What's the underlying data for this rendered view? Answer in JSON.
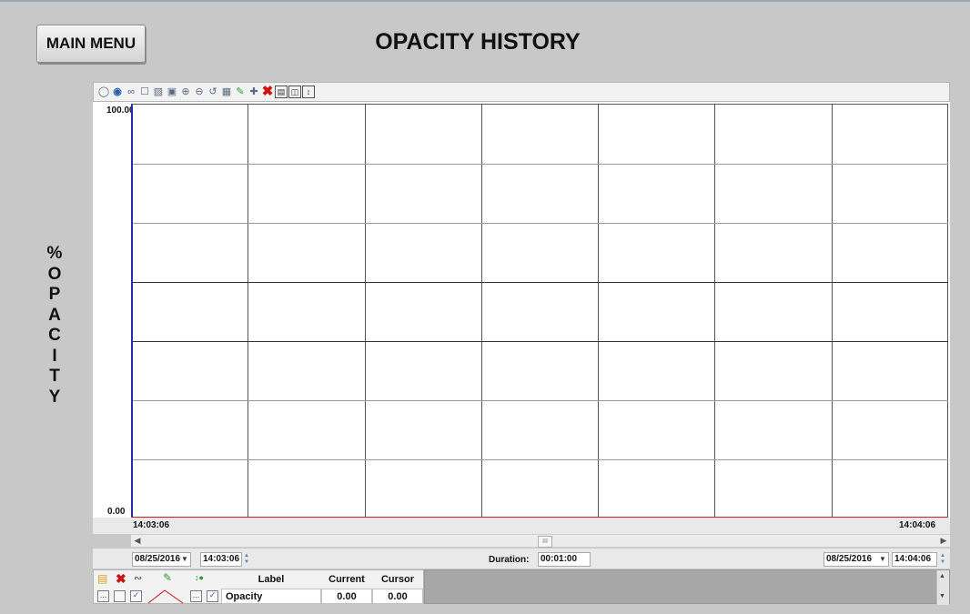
{
  "header": {
    "main_menu_label": "MAIN MENU",
    "title": "OPACITY HISTORY"
  },
  "y_axis_label": [
    "%",
    "O",
    "P",
    "A",
    "C",
    "I",
    "T",
    "Y"
  ],
  "toolbar": {
    "icons": [
      "refresh-icon",
      "info-icon",
      "link-icon",
      "zoom-box-icon",
      "zoom-range-icon",
      "zoom-fit-icon",
      "zoom-in-icon",
      "zoom-out-icon",
      "zoom-reset-icon",
      "grid-icon",
      "edit-pen-icon",
      "add-cursor-icon",
      "delete-icon",
      "panel-icon",
      "layout-icon",
      "scale-icon"
    ]
  },
  "chart_data": {
    "type": "line",
    "title": "OPACITY HISTORY",
    "ylabel": "% OPACITY",
    "xlabel": "",
    "ylim": [
      0.0,
      100.0
    ],
    "y_tick_labels": [
      "100.00",
      "0.00"
    ],
    "x_tick_labels": [
      "14:03:06",
      "14:04:06"
    ],
    "grid": true,
    "grid_rows": 7,
    "grid_cols": 7,
    "series": [
      {
        "name": "Opacity",
        "color": "#c02020",
        "x": [
          "14:03:06",
          "14:04:06"
        ],
        "values": [
          0.0,
          0.0
        ]
      }
    ]
  },
  "time_controls": {
    "start_date": "08/25/2016",
    "start_time": "14:03:06",
    "duration_label": "Duration:",
    "duration": "00:01:00",
    "end_date": "08/25/2016",
    "end_time": "14:04:06"
  },
  "legend": {
    "headers": {
      "label": "Label",
      "current": "Current",
      "cursor": "Cursor"
    },
    "rows": [
      {
        "label": "Opacity",
        "current": "0.00",
        "cursor": "0.00",
        "visible": true,
        "color": "#c02020"
      }
    ]
  },
  "colors": {
    "background": "#c8c8c8",
    "trend_line": "#c02020",
    "axis_left": "#2a2ab0"
  }
}
